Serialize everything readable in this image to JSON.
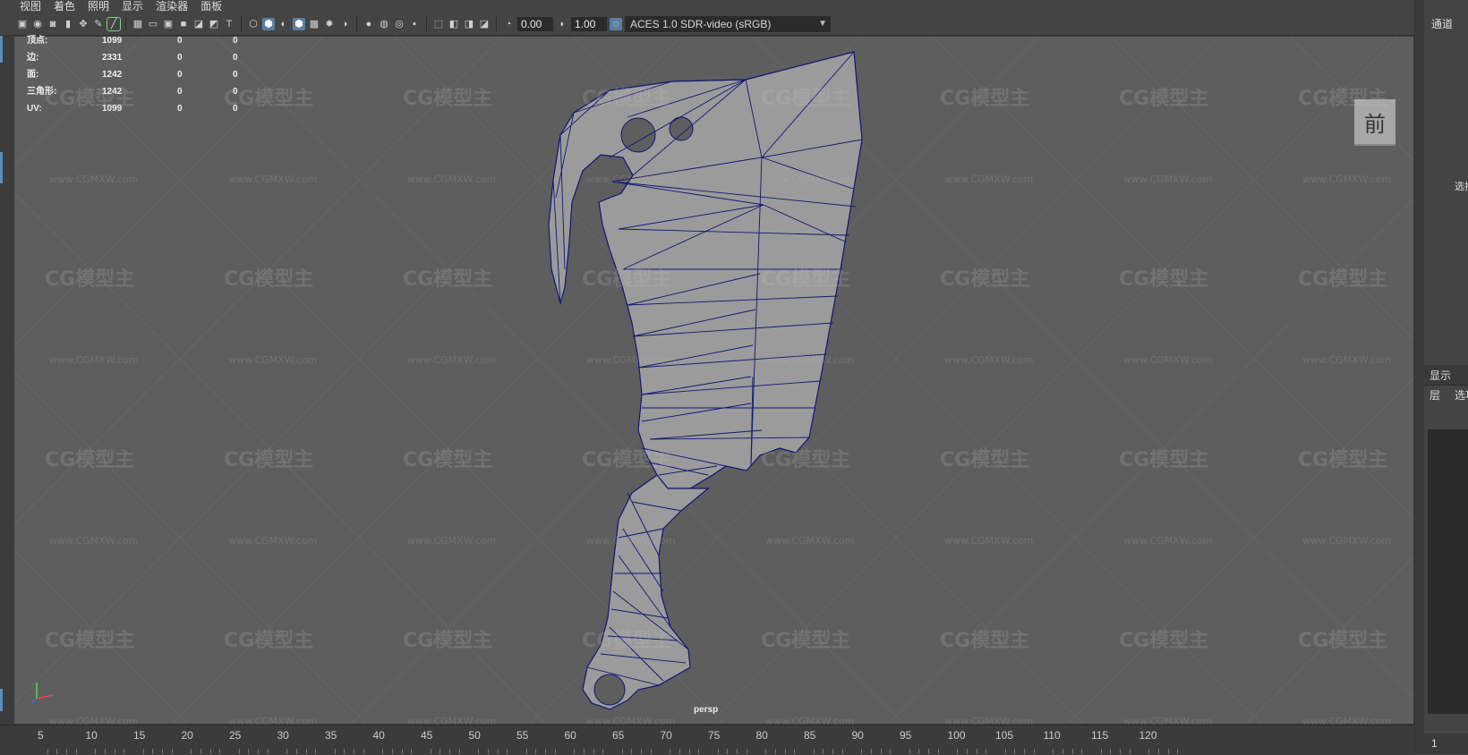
{
  "menu": {
    "items": [
      "视图",
      "着色",
      "照明",
      "显示",
      "渲染器",
      "面板"
    ]
  },
  "toolbar": {
    "exposure_value": "0.00",
    "gamma_value": "1.00",
    "color_management": "ACES 1.0 SDR-video (sRGB)"
  },
  "hud": {
    "rows": [
      {
        "label": "顶点:",
        "v1": "1099",
        "v2": "0",
        "v3": "0"
      },
      {
        "label": "边:",
        "v1": "2331",
        "v2": "0",
        "v3": "0"
      },
      {
        "label": "面:",
        "v1": "1242",
        "v2": "0",
        "v3": "0"
      },
      {
        "label": "三角形:",
        "v1": "1242",
        "v2": "0",
        "v3": "0"
      },
      {
        "label": "UV:",
        "v1": "1099",
        "v2": "0",
        "v3": "0"
      }
    ]
  },
  "viewcube": {
    "label": "前"
  },
  "camera": {
    "label": "persp"
  },
  "right_panel": {
    "channels_label": "通道",
    "select_label": "选择",
    "display_tab": "显示",
    "layer_label": "层",
    "options_label": "选项",
    "bottom_value": "1"
  },
  "watermark": {
    "logo": "CG模型主",
    "url": "www.CGMXW.com"
  },
  "timeline": {
    "ticks": [
      "5",
      "10",
      "15",
      "20",
      "25",
      "30",
      "35",
      "40",
      "45",
      "50",
      "55",
      "60",
      "65",
      "70",
      "75",
      "80",
      "85",
      "90",
      "95",
      "100",
      "105",
      "110",
      "115",
      "120"
    ]
  },
  "colors": {
    "mesh_fill": "#9b9b9b",
    "wire": "#1a1a7a",
    "viewport_bg": "#5e5e5e",
    "accent": "#5a7fa0"
  }
}
